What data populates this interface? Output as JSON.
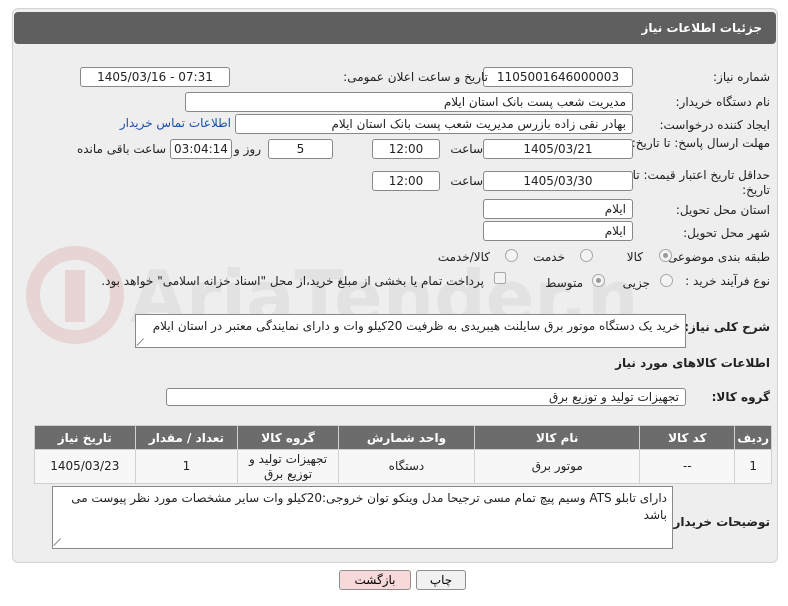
{
  "header": {
    "title": "جزئیات اطلاعات نیاز"
  },
  "labels": {
    "need_number": "شماره نیاز:",
    "announce_datetime": "تاریخ و ساعت اعلان عمومی:",
    "buyer_org": "نام دستگاه خریدار:",
    "requester": "ایجاد کننده درخواست:",
    "reply_deadline": "مهلت ارسال پاسخ: تا تاریخ:",
    "price_validity": "حداقل تاریخ اعتبار قیمت: تا تاریخ:",
    "time": "ساعت",
    "day_and": "روز و",
    "remaining": "ساعت باقی مانده",
    "province": "استان محل تحویل:",
    "city": "شهر محل تحویل:",
    "category": "طبقه بندی موضوعی:",
    "process_type": "نوع فرآیند خرید :",
    "general_desc": "شرح کلی نیاز:",
    "goods_info": "اطلاعات کالاهای مورد نیاز",
    "goods_group": "گروه کالا:",
    "buyer_notes": "توضیحات خریدار:"
  },
  "fields": {
    "need_number": "1105001646000003",
    "announce_datetime": "1405/03/16 - 07:31",
    "buyer_org": "مدیریت شعب پست بانک استان ایلام",
    "requester": "بهادر نقی زاده بازرس مدیریت شعب پست بانک استان ایلام",
    "contact_link": "اطلاعات تماس خریدار",
    "reply_date": "1405/03/21",
    "reply_time": "12:00",
    "days": "5",
    "remaining_time": "03:04:14",
    "price_date": "1405/03/30",
    "price_time": "12:00",
    "province": "ایلام",
    "city": "ایلام",
    "goods_group": "تجهیزات تولید و توزیع برق"
  },
  "category_options": [
    {
      "label": "کالا",
      "selected": true
    },
    {
      "label": "خدمت",
      "selected": false
    },
    {
      "label": "کالا/خدمت",
      "selected": false
    }
  ],
  "process_options": [
    {
      "label": "جزیی",
      "selected": false
    },
    {
      "label": "متوسط",
      "selected": true
    }
  ],
  "payment_note": "پرداخت تمام یا بخشی از مبلغ خرید،از محل \"اسناد خزانه اسلامی\" خواهد بود.",
  "general_desc": "خرید یک دستگاه موتور برق سایلنت هیبریدی به ظرفیت 20کیلو وات و دارای نمایندگی معتبر در استان ایلام",
  "table": {
    "headers": [
      "ردیف",
      "کد کالا",
      "نام کالا",
      "واحد شمارش",
      "گروه کالا",
      "تعداد / مقدار",
      "تاریخ نیاز"
    ],
    "rows": [
      [
        "1",
        "--",
        "موتور برق",
        "دستگاه",
        "تجهیزات تولید و توزیع برق",
        "1",
        "1405/03/23"
      ]
    ]
  },
  "buyer_notes": "دارای تابلو ATS وسیم پیچ تمام مسی ترجیحا مدل وینکو توان خروجی:20کیلو وات سایر مشخصات مورد نظر پیوست می باشد",
  "buttons": {
    "print": "چاپ",
    "back": "بازگشت"
  },
  "watermark_text": "AriaTender.neT"
}
